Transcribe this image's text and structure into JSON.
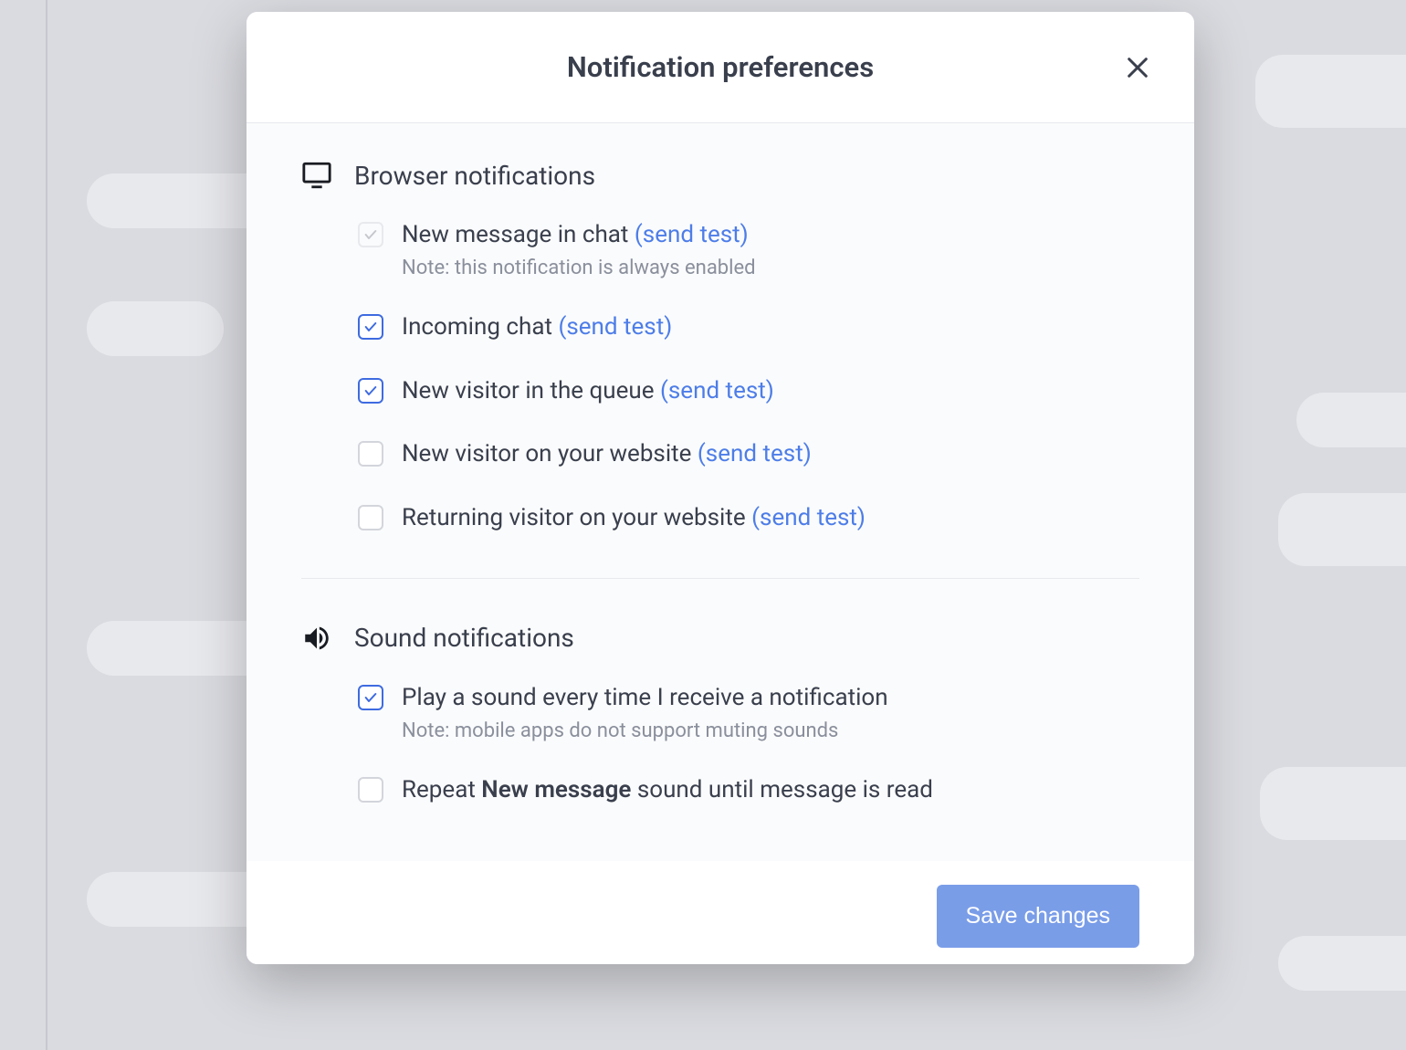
{
  "modal": {
    "title": "Notification preferences",
    "browser_section": {
      "title": "Browser notifications",
      "options": [
        {
          "label": "New message in chat",
          "send_test": "(send test)",
          "note": "Note: this notification is always enabled",
          "state": "disabled"
        },
        {
          "label": "Incoming chat",
          "send_test": "(send test)",
          "state": "checked"
        },
        {
          "label": "New visitor in the queue",
          "send_test": "(send test)",
          "state": "checked"
        },
        {
          "label": "New visitor on your website",
          "send_test": "(send test)",
          "state": "unchecked"
        },
        {
          "label": "Returning visitor on your website",
          "send_test": "(send test)",
          "state": "unchecked"
        }
      ]
    },
    "sound_section": {
      "title": "Sound notifications",
      "options": [
        {
          "label": "Play a sound every time I receive a notification",
          "note": "Note: mobile apps do not support muting sounds",
          "state": "checked"
        },
        {
          "label_before": "Repeat ",
          "label_bold": "New message",
          "label_after": " sound until message is read",
          "state": "unchecked"
        }
      ]
    },
    "save_button": "Save changes"
  }
}
